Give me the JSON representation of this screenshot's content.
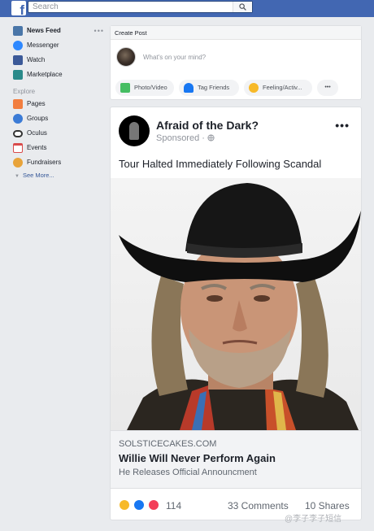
{
  "header": {
    "search_placeholder": "Search",
    "logo_letter": "f",
    "brand_color": "#4267b2"
  },
  "sidebar": {
    "items": [
      {
        "label": "News Feed",
        "icon": "news-feed-icon",
        "color": "#4a76a8",
        "active": true
      },
      {
        "label": "Messenger",
        "icon": "messenger-icon",
        "color": "#2d88ff"
      },
      {
        "label": "Watch",
        "icon": "watch-icon",
        "color": "#3b5998"
      },
      {
        "label": "Marketplace",
        "icon": "marketplace-icon",
        "color": "#2a8a8a"
      }
    ],
    "more_glyph": "•••",
    "explore_heading": "Explore",
    "explore_items": [
      {
        "label": "Pages",
        "icon": "pages-icon",
        "color": "#f27e3f"
      },
      {
        "label": "Groups",
        "icon": "groups-icon",
        "color": "#3b7bd6"
      },
      {
        "label": "Oculus",
        "icon": "oculus-icon",
        "color": "#333333"
      },
      {
        "label": "Events",
        "icon": "events-icon",
        "color": "#d94b4b"
      },
      {
        "label": "Fundraisers",
        "icon": "fundraisers-icon",
        "color": "#e8a33a"
      }
    ],
    "see_more": "See More..."
  },
  "composer": {
    "heading": "Create Post",
    "placeholder": "What's on your mind?",
    "actions": [
      {
        "label": "Photo/Video",
        "icon": "photo-video-icon",
        "color": "#45bd62"
      },
      {
        "label": "Tag Friends",
        "icon": "tag-friends-icon",
        "color": "#1877f2"
      },
      {
        "label": "Feeling/Activ...",
        "icon": "feeling-icon",
        "color": "#f7b928"
      }
    ],
    "more_glyph": "•••"
  },
  "post": {
    "page_name": "Afraid of the Dark?",
    "sponsored": "Sponsored · ",
    "menu_glyph": "•••",
    "text": "Tour Halted Immediately Following Scandal",
    "link": {
      "domain": "SOLSTICECAKES.COM",
      "title": "Willie Will Never Perform Again",
      "description": "He Releases Official Announcment"
    },
    "reactions": {
      "icons": [
        "sad-reaction-icon",
        "like-reaction-icon",
        "love-reaction-icon"
      ],
      "count": "114",
      "comments": "33 Comments",
      "shares": "10 Shares"
    }
  },
  "watermark": "@李子李子短信"
}
